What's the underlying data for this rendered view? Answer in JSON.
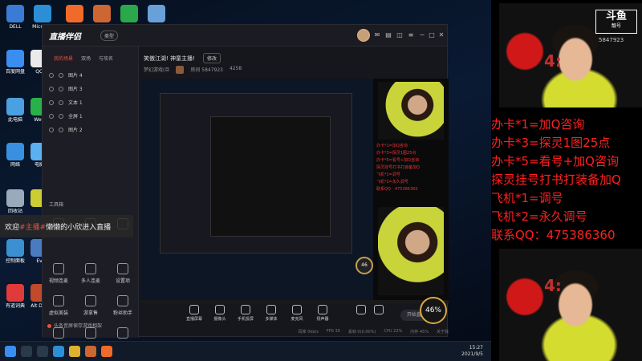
{
  "desktop": {
    "icons": [
      {
        "label": "DELL",
        "color": "#3a7bd5"
      },
      {
        "label": "Micro Ed",
        "color": "#2c8fd6"
      },
      {
        "label": "",
        "color": "#f06a2a"
      },
      {
        "label": "",
        "color": "#cc6633"
      },
      {
        "label": "",
        "color": "#2ba84a"
      },
      {
        "label": "",
        "color": "#6aa0d8"
      },
      {
        "label": "百度网盘",
        "color": "#3a8ef0"
      },
      {
        "label": "QQ",
        "color": "#eaeaea"
      },
      {
        "label": "此电脑",
        "color": "#4aa0e0"
      },
      {
        "label": "WeC",
        "color": "#2ab04a"
      },
      {
        "label": "网络",
        "color": "#3a90e0"
      },
      {
        "label": "电脑",
        "color": "#5ab0f0"
      },
      {
        "label": "回收站",
        "color": "#9ab"
      },
      {
        "label": "",
        "color": "#cc3"
      },
      {
        "label": "控制面板",
        "color": "#3a90d0"
      },
      {
        "label": "Ev",
        "color": "#4a7ac0"
      },
      {
        "label": "有道词典",
        "color": "#e03a3a"
      },
      {
        "label": "Alt Des",
        "color": "#c04a2a"
      }
    ]
  },
  "taskbar": {
    "time": "15:27",
    "date": "2021/9/5"
  },
  "app": {
    "logo": "直播伴侣",
    "version_badge": "类型",
    "left_tabs": [
      "我的场景",
      "双场",
      "与攻名"
    ],
    "sources": [
      "图片 4",
      "图片 3",
      "文本 1",
      "全屏 1",
      "图片 2"
    ],
    "toolbox_label": "工具箱",
    "tools": [
      "",
      "",
      "",
      "",
      "",
      "",
      "视频连麦",
      "多人连麦",
      "设置项",
      "虚拟美装",
      "游拿售",
      "粉丝助手"
    ],
    "bottom_hint": "头条音屏保存游戏相架",
    "stream_title": "笑傲江湖! 神童主播!",
    "edit_button": "修改",
    "room_label": "梦幻游戏(旦",
    "room_id": "房间 5847923",
    "room_count": "4258",
    "bottom_buttons": [
      "直播屏幕",
      "摄像头",
      "手机投屏",
      "多媒体",
      "麦克风",
      "扬声器"
    ],
    "start_button": "开始直播",
    "gauge_value": "46%",
    "mini_gauge_value": "46",
    "stats": [
      "码率 0kb/s",
      "FPS 30",
      "丢帧 0(0.00%)",
      "CPU 22%",
      "内存 45%",
      "关于我"
    ]
  },
  "overlay": {
    "welcome_prefix": "欢迎",
    "welcome_highlight": "#主播#",
    "welcome_suffix": "懒懒的小欣进入直播"
  },
  "promo": {
    "four_label": "4:",
    "brand_title": "斗鱼",
    "brand_sub": "靓号",
    "brand_id": "5847923",
    "price_list": [
      "办卡*1=加Q咨询",
      "办卡*3=探灵1图25点",
      "办卡*5=看号+加Q咨询",
      "探灵挂号打书打装备加Q",
      "飞机*1=调号",
      "飞机*2=永久调号",
      "联系QQ：475386360"
    ],
    "text_color": "#ff2020"
  }
}
